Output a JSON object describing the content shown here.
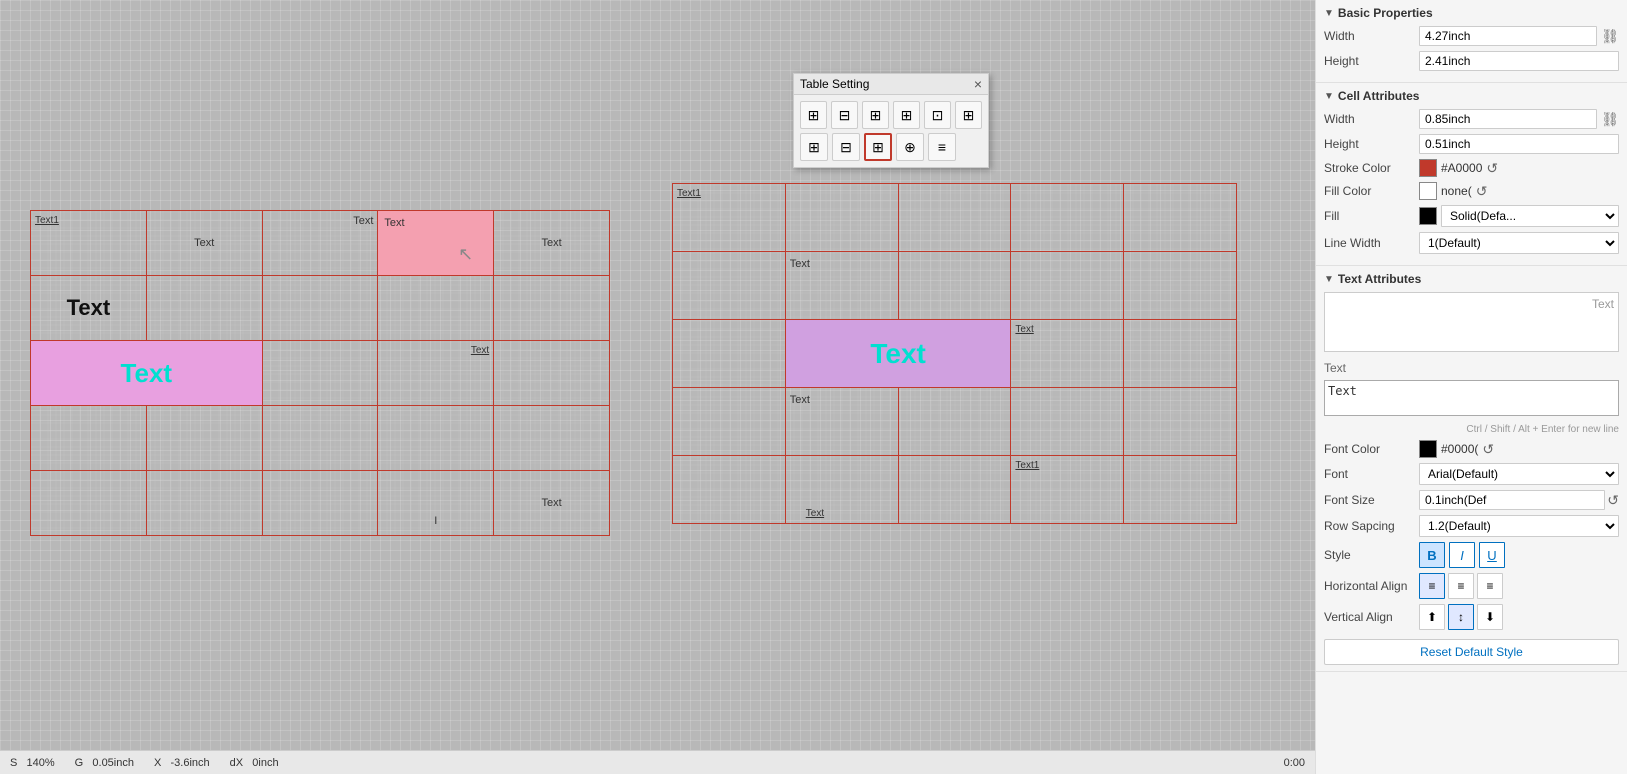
{
  "canvas": {
    "background": "#b0b0b0"
  },
  "table_setting_dialog": {
    "title": "Table Setting",
    "close_label": "×",
    "row1_icons": [
      "⊞",
      "⊟",
      "⊠",
      "⊡",
      "⊞",
      "⊟"
    ],
    "row2_icons": [
      "⊞",
      "⊟",
      "⊞",
      "⊞",
      "≡"
    ]
  },
  "left_table": {
    "cells": [
      [
        "Text1",
        "",
        "Text",
        "Text",
        "Text"
      ],
      [
        "Text",
        "",
        "",
        "",
        ""
      ],
      [
        "Text",
        "",
        "",
        "Text",
        ""
      ],
      [
        "",
        "",
        "",
        "",
        ""
      ],
      [
        "",
        "",
        "",
        "I",
        "Text"
      ]
    ]
  },
  "right_table": {
    "cells": [
      [
        "Text1",
        "",
        "",
        "",
        ""
      ],
      [
        "",
        "Text",
        "",
        "",
        ""
      ],
      [
        "",
        "Text",
        "",
        "Text",
        ""
      ],
      [
        "",
        "Text",
        "",
        "",
        ""
      ],
      [
        "",
        "Text",
        "",
        "Text1",
        ""
      ]
    ]
  },
  "right_panel": {
    "basic_properties": {
      "title": "Basic Properties",
      "width_label": "Width",
      "width_value": "4.27inch",
      "height_label": "Height",
      "height_value": "2.41inch"
    },
    "cell_attributes": {
      "title": "Cell Attributes",
      "width_label": "Width",
      "width_value": "0.85inch",
      "height_label": "Height",
      "height_value": "0.51inch",
      "stroke_color_label": "Stroke Color",
      "stroke_color_hex": "#A0000",
      "stroke_color_display": "#A0000",
      "fill_color_label": "Fill Color",
      "fill_color_value": "none(",
      "fill_label": "Fill",
      "fill_value": "Solid(Defa...",
      "line_width_label": "Line Width",
      "line_width_value": "1(Default)"
    },
    "text_attributes": {
      "title": "Text Attributes",
      "text_display": "Text",
      "text_value": "Text",
      "hint": "Ctrl / Shift / Alt + Enter for new line",
      "font_color_label": "Font Color",
      "font_color_hex": "#0000(",
      "font_label": "Font",
      "font_value": "Arial(Default)",
      "font_size_label": "Font Size",
      "font_size_value": "0.1inch(Def",
      "row_spacing_label": "Row Sapcing",
      "row_spacing_value": "1.2(Default)",
      "style_label": "Style",
      "h_align_label": "Horizontal Align",
      "v_align_label": "Vertical Align",
      "reset_label": "Reset Default Style"
    }
  },
  "status_bar": {
    "s_label": "S",
    "s_value": "140%",
    "g_label": "G",
    "g_value": "0.05inch",
    "x_label": "X",
    "x_value": "-3.6inch",
    "dx_label": "dX",
    "dx_value": "0inch",
    "time": "0:00"
  }
}
